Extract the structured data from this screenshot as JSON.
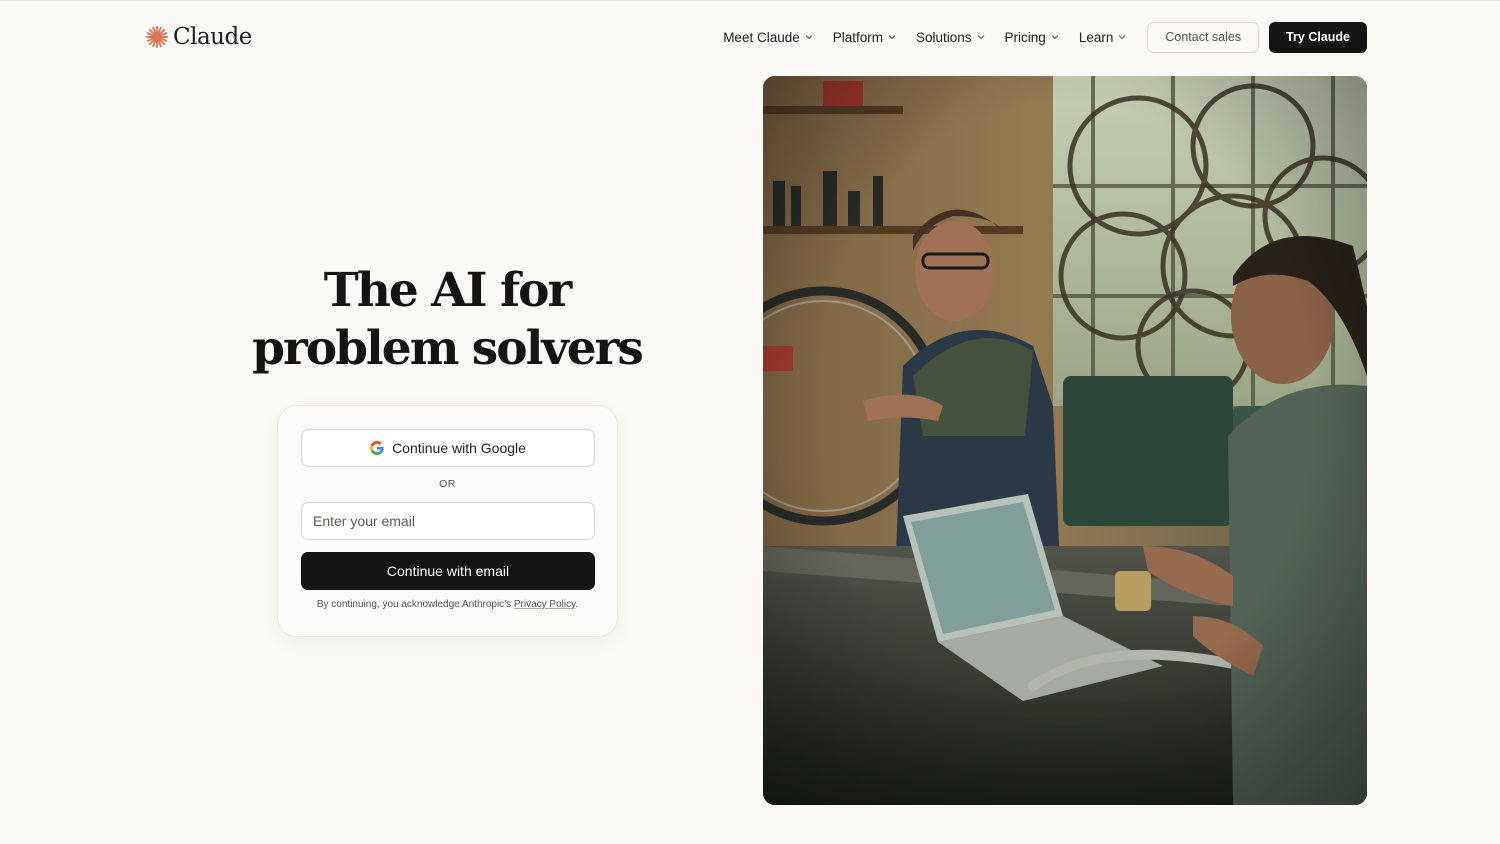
{
  "brand": {
    "name": "Claude",
    "accent": "#d97757"
  },
  "nav": {
    "items": [
      {
        "label": "Meet Claude"
      },
      {
        "label": "Platform"
      },
      {
        "label": "Solutions"
      },
      {
        "label": "Pricing"
      },
      {
        "label": "Learn"
      }
    ],
    "contact_label": "Contact sales",
    "try_label": "Try Claude"
  },
  "hero": {
    "title_line1": "The AI for",
    "title_line2": "problem solvers"
  },
  "auth": {
    "google_label": "Continue with Google",
    "or_label": "OR",
    "email_placeholder": "Enter your email",
    "email_button_label": "Continue with email",
    "legal_prefix": "By continuing, you acknowledge Anthropic's ",
    "legal_link": "Privacy Policy",
    "legal_suffix": "."
  },
  "photo": {
    "subject": "two men working in a bicycle workshop with a laptop"
  },
  "icons": {
    "logo": "claude-starburst-icon",
    "nav_chevron": "chevron-down-icon",
    "google": "google-g-icon"
  }
}
